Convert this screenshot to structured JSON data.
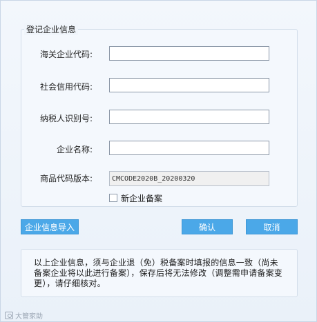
{
  "group": {
    "title": "登记企业信息"
  },
  "fields": [
    {
      "label": "海关企业代码:",
      "value": ""
    },
    {
      "label": "社会信用代码:",
      "value": ""
    },
    {
      "label": "纳税人识别号:",
      "value": ""
    },
    {
      "label": "企业名称:",
      "value": ""
    },
    {
      "label": "商品代码版本:",
      "value": "CMCODE2020B_20200320"
    }
  ],
  "checkbox": {
    "label": "新企业备案",
    "checked": false
  },
  "buttons": {
    "import": "企业信息导入",
    "confirm": "确认",
    "cancel": "取消"
  },
  "notice": "以上企业信息，须与企业退（免）税备案时填报的信息一致（尚未备案企业将以此进行备案），保存后将无法修改（调整需申请备案变更），请仔细核对。",
  "watermark": "大管家助",
  "colors": {
    "button": "#4ba8e8",
    "background": "#eef3fa",
    "border": "#d3deea"
  }
}
